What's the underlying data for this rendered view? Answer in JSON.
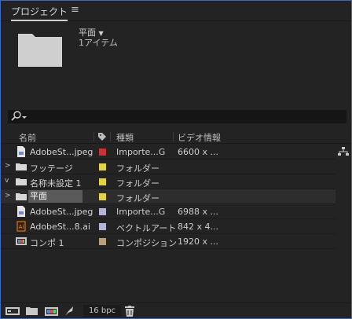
{
  "panel": {
    "title": "プロジェクト",
    "menu_icon": "hamburger-icon"
  },
  "selected_info": {
    "name": "平面",
    "dropdown": "▼",
    "count": "1アイテム"
  },
  "search": {
    "icon": "search-icon",
    "value": ""
  },
  "columns": {
    "name": "名前",
    "label": "label-icon",
    "type": "種類",
    "video": "ビデオ情報"
  },
  "rows": [
    {
      "name": "AdobeSt...jpeg",
      "icon": "image-file-icon",
      "color": "#c83232",
      "type": "Importe...G",
      "video": "6600 x ..."
    },
    {
      "name": "フッテージ",
      "icon": "folder-icon",
      "color": "#e2d24a",
      "type": "フォルダー",
      "video": "",
      "arrow": ">"
    },
    {
      "name": "名称未設定 1",
      "icon": "folder-icon",
      "color": "#e2d24a",
      "type": "フォルダー",
      "video": "",
      "arrow": "v"
    },
    {
      "name": "平面",
      "icon": "folder-icon",
      "color": "#e2d24a",
      "type": "フォルダー",
      "video": "",
      "arrow": ">"
    },
    {
      "name": "AdobeSt...jpeg",
      "icon": "image-file-icon",
      "color": "#b4b4d6",
      "type": "Importe...G",
      "video": "6988 x ..."
    },
    {
      "name": "AdobeSt...8.ai",
      "icon": "illustrator-file-icon",
      "color": "#b4b4d6",
      "type": "ベクトルアート",
      "video": "842 x 4..."
    },
    {
      "name": "コンポ 1",
      "icon": "composition-icon",
      "color": "#b8a07a",
      "type": "コンポジション",
      "video": "1920 x ..."
    }
  ],
  "footer": {
    "bpc": "16 bpc"
  }
}
